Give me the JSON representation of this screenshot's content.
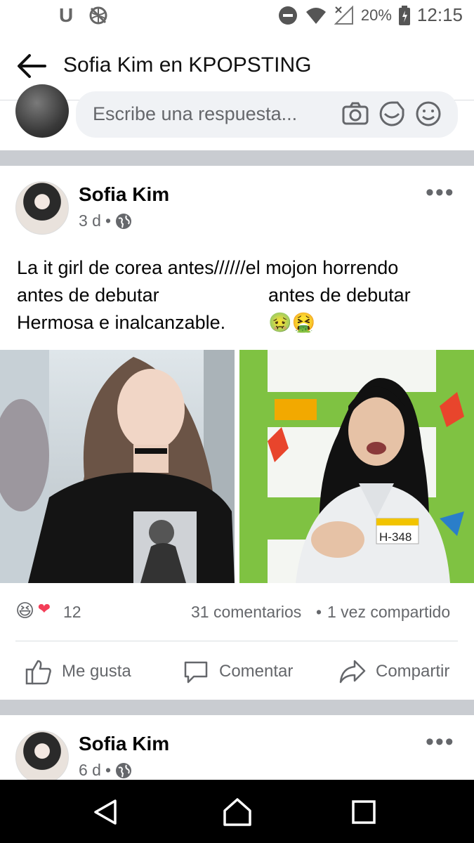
{
  "status_bar": {
    "carrier_glyph": "U",
    "battery": "20%",
    "time": "12:15",
    "icons": [
      "network-off-icon",
      "dnd-icon",
      "wifi-icon",
      "signal-icon",
      "battery-icon"
    ]
  },
  "header": {
    "title": "Sofia Kim en KPOPSTING",
    "back_icon": "arrow-left-icon"
  },
  "reply": {
    "placeholder": "Escribe una respuesta...",
    "icons": [
      "camera-icon",
      "gif-sticker-icon",
      "emoji-icon"
    ]
  },
  "post": {
    "author": "Sofia Kim",
    "time": "3 d",
    "privacy_icon": "globe-icon",
    "text_rows": [
      [
        "La it girl de corea antes//////el mojon horrendo",
        ""
      ],
      [
        "antes de debutar",
        "antes de debutar"
      ],
      [
        "Hermosa e inalcanzable.",
        "🤢🤮"
      ]
    ],
    "photo_badge": "H-348",
    "reaction_count": "12",
    "reactions": [
      "😆",
      "❤"
    ],
    "comments": "31 comentarios",
    "shares": "1 vez compartido",
    "actions": {
      "like": "Me gusta",
      "comment": "Comentar",
      "share": "Compartir"
    }
  },
  "next_post": {
    "author": "Sofia Kim",
    "time": "6 d"
  },
  "colors": {
    "separator": "#c9ccd1",
    "secondary_text": "#65676b",
    "input_bg": "#f0f2f5",
    "nav_bg": "#000000"
  }
}
